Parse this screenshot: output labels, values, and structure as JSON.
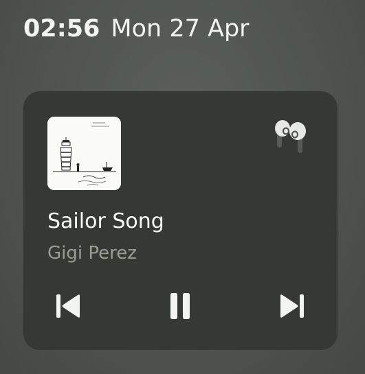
{
  "status_bar": {
    "time": "02:56",
    "date": "Mon 27 Apr"
  },
  "media_player": {
    "track_title": "Sailor Song",
    "artist": "Gigi Perez",
    "album_art_icon": "album-art-lighthouse",
    "output_device_icon": "earbuds-icon",
    "controls": {
      "previous_icon": "skip-previous-icon",
      "play_pause_icon": "pause-icon",
      "next_icon": "skip-next-icon"
    }
  },
  "colors": {
    "background": "#51564f",
    "card": "#363933",
    "title_text": "#fbfbf8",
    "artist_text": "#9a9d96"
  }
}
